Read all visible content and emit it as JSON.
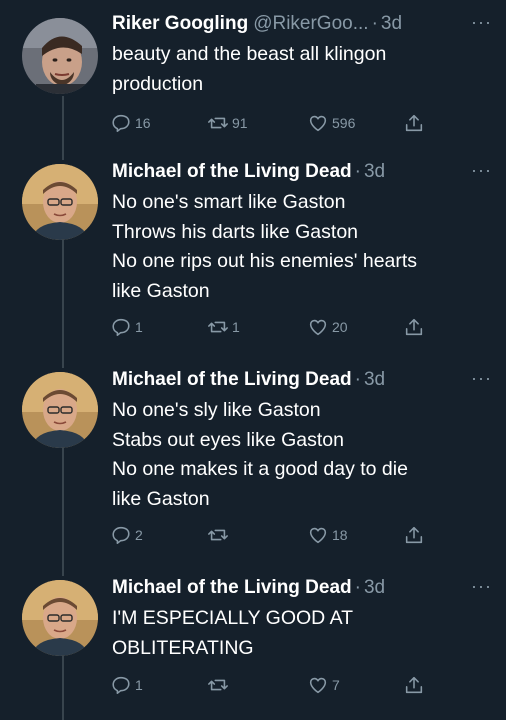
{
  "tweets": [
    {
      "name": "Riker Googling",
      "handle": "@RikerGoo...",
      "separator": "·",
      "time": "3d",
      "more": "···",
      "lines": [
        "beauty and the beast all klingon",
        "production"
      ],
      "replies": "16",
      "retweets": "91",
      "likes": "596",
      "avatar": "riker-avatar"
    },
    {
      "name": "Michael of the Living Dead",
      "handle": "",
      "separator": "·",
      "time": "3d",
      "more": "···",
      "lines": [
        "No one's smart like Gaston",
        "Throws his darts like Gaston",
        "No one rips out his enemies' hearts",
        "like Gaston"
      ],
      "replies": "1",
      "retweets": "1",
      "likes": "20",
      "avatar": "michael-avatar"
    },
    {
      "name": "Michael of the Living Dead",
      "handle": "",
      "separator": "·",
      "time": "3d",
      "more": "···",
      "lines": [
        "No one's sly like Gaston",
        "Stabs out eyes like Gaston",
        "No one makes it a good day to die",
        "like Gaston"
      ],
      "replies": "2",
      "retweets": "",
      "likes": "18",
      "avatar": "michael-avatar"
    },
    {
      "name": "Michael of the Living Dead",
      "handle": "",
      "separator": "·",
      "time": "3d",
      "more": "···",
      "lines": [
        "I'M ESPECIALLY GOOD AT",
        "OBLITERATING"
      ],
      "replies": "1",
      "retweets": "",
      "likes": "7",
      "avatar": "michael-avatar"
    }
  ],
  "colors": {
    "background": "#15202b",
    "text": "#ffffff",
    "secondary": "#8899a6",
    "thread_line": "#38444d"
  }
}
